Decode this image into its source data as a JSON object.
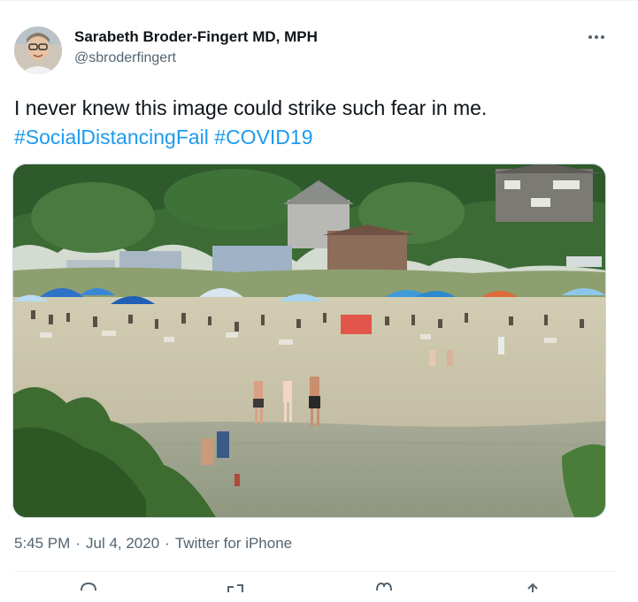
{
  "author": {
    "name": "Sarabeth Broder-Fingert MD, MPH",
    "handle": "@sbroderfingert"
  },
  "tweet": {
    "text": "I never knew this image could strike such fear in me.",
    "hashtags": [
      "#SocialDistancingFail",
      "#COVID19"
    ],
    "time": "5:45 PM",
    "separator": "·",
    "date": "Jul 4, 2020",
    "source": "Twitter for iPhone"
  },
  "colors": {
    "link": "#1d9bf0",
    "secondary_text": "#536471",
    "primary_text": "#0f1419"
  },
  "icons": [
    "more-options-icon",
    "reply-icon",
    "retweet-icon",
    "like-icon",
    "share-icon"
  ]
}
